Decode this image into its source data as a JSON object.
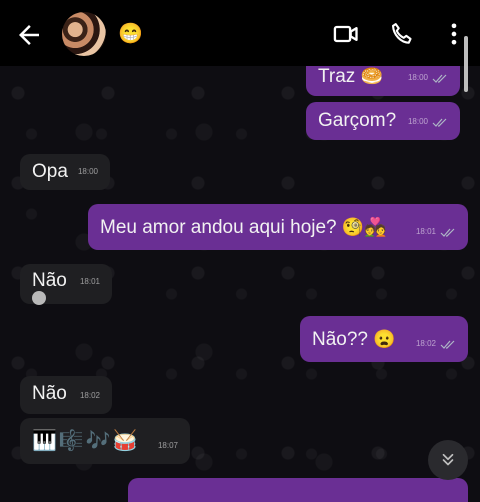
{
  "header": {
    "contact_emoji": "😁",
    "icons": [
      "back-arrow-icon",
      "video-call-icon",
      "phone-icon",
      "more-vertical-icon"
    ]
  },
  "messages": [
    {
      "dir": "out",
      "text": "Traz",
      "emoji": "🥯",
      "time": "18:00"
    },
    {
      "dir": "out",
      "text": "Garçom?",
      "time": "18:00"
    },
    {
      "dir": "in",
      "text": "Opa",
      "time": "18:00"
    },
    {
      "dir": "out",
      "text": "Meu amor andou aqui hoje?",
      "emoji": "🧐💑",
      "time": "18:01"
    },
    {
      "dir": "in",
      "text": "Não",
      "time": "18:01"
    },
    {
      "dir": "out",
      "text": "Não??",
      "emoji": "😦",
      "time": "18:02"
    },
    {
      "dir": "in",
      "text": "Não",
      "time": "18:02"
    },
    {
      "dir": "in",
      "text": "🎹🎼🎶🥁",
      "time": "18:07"
    }
  ],
  "colors": {
    "outgoing_bubble": "#6a2f94",
    "incoming_bubble": "#1f1f22",
    "header_bg": "#000000",
    "chat_bg": "#0e0d12"
  }
}
